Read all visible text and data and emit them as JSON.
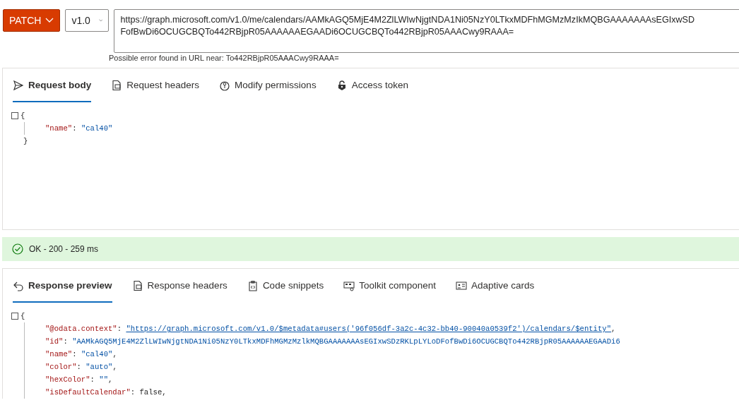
{
  "request": {
    "method": "PATCH",
    "version": "v1.0",
    "url_lines": [
      "https://graph.microsoft.com/v1.0/me/calendars/AAMkAGQ5MjE4M2ZlLWIwNjgtNDA1Ni05NzY0LTkxMDFhMGMzMzIkMQBGAAAAAAAsEGIxwSD",
      "FofBwDi6OCUGCBQTo442RBjpR05AAAAAAEGAADi6OCUGCBQTo442RBjpR05AAACwy9RAAA="
    ],
    "url_hint": "Possible error found in URL near: To442RBjpR05AAACwy9RAAA="
  },
  "request_tabs": [
    {
      "label": "Request body",
      "selected": true
    },
    {
      "label": "Request headers",
      "selected": false
    },
    {
      "label": "Modify permissions",
      "selected": false
    },
    {
      "label": "Access token",
      "selected": false
    }
  ],
  "request_body": {
    "open": "{",
    "close": "}",
    "pairs": [
      {
        "key": "\"name\"",
        "punct": ": ",
        "value": "\"cal40\"",
        "kind": "string"
      }
    ]
  },
  "status": {
    "text": "OK - 200 - 259 ms",
    "ok": true
  },
  "response_tabs": [
    {
      "label": "Response preview",
      "selected": true
    },
    {
      "label": "Response headers",
      "selected": false
    },
    {
      "label": "Code snippets",
      "selected": false
    },
    {
      "label": "Toolkit component",
      "selected": false
    },
    {
      "label": "Adaptive cards",
      "selected": false
    }
  ],
  "response_body": {
    "open": "{",
    "pairs": [
      {
        "key": "\"@odata.context\"",
        "punct": ": ",
        "value": "\"https://graph.microsoft.com/v1.0/$metadata#users('96f056df-3a2c-4c32-bb40-90040a0539f2')/calendars/$entity\"",
        "kind": "link",
        "trail": ","
      },
      {
        "key": "\"id\"",
        "punct": ": ",
        "value": "\"AAMkAGQ5MjE4M2ZlLWIwNjgtNDA1Ni05NzY0LTkxMDFhMGMzMzlkMQBGAAAAAAAsEGIxwSDzRKLpLYLoDFofBwDi6OCUGCBQTo442RBjpR05AAAAAAEGAADi6",
        "kind": "string"
      },
      {
        "key": "\"name\"",
        "punct": ": ",
        "value": "\"cal40\"",
        "kind": "string",
        "trail": ","
      },
      {
        "key": "\"color\"",
        "punct": ": ",
        "value": "\"auto\"",
        "kind": "string",
        "trail": ","
      },
      {
        "key": "\"hexColor\"",
        "punct": ": ",
        "value": "\"\"",
        "kind": "string",
        "trail": ","
      },
      {
        "key": "\"isDefaultCalendar\"",
        "punct": ": ",
        "value": "false",
        "kind": "literal",
        "trail": ","
      }
    ]
  }
}
